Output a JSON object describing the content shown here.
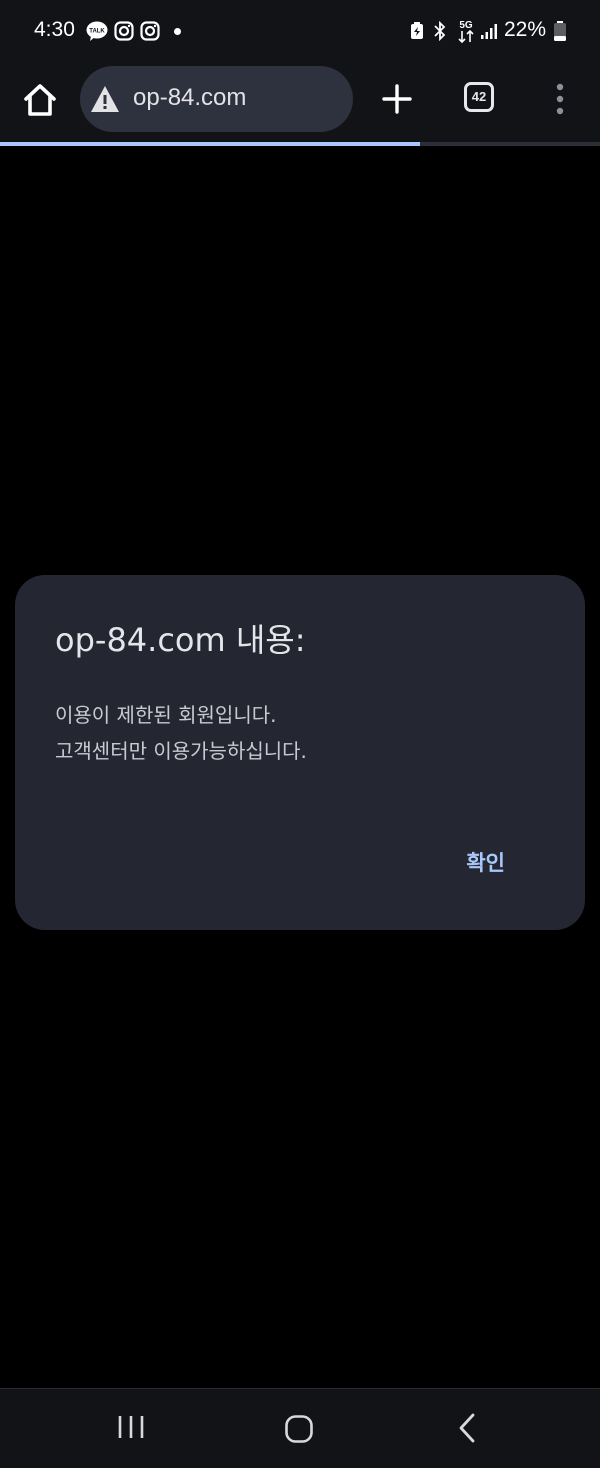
{
  "status_bar": {
    "time": "4:30",
    "notification_icons": [
      "kakaotalk-icon",
      "instagram-icon",
      "instagram-icon"
    ],
    "system_icons": [
      "battery-saver-icon",
      "bluetooth-icon",
      "5g-icon",
      "signal-icon"
    ],
    "network_label": "5G",
    "battery": "22%"
  },
  "toolbar": {
    "url": "op-84.com",
    "security_icon": "warning-icon",
    "tab_count": "42",
    "page_load_progress": 0.7
  },
  "dialog": {
    "title": "op-84.com 내용:",
    "message_lines": [
      "이용이 제한된 회원입니다.",
      "고객센터만 이용가능하십니다."
    ],
    "ok_label": "확인"
  },
  "colors": {
    "accent": "#a8c7fa",
    "dialog_bg": "#242731",
    "chrome_bg": "#121317",
    "url_bar_bg": "#2e323f",
    "page_bg": "#000000"
  },
  "nav_bar": {
    "icons": [
      "recents-icon",
      "home-icon",
      "back-icon"
    ]
  }
}
